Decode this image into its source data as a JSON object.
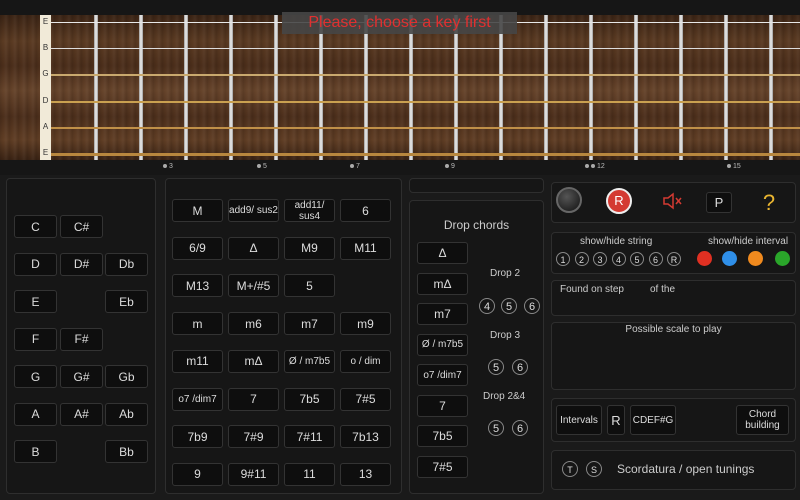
{
  "fretboard": {
    "strings": [
      "E",
      "B",
      "G",
      "D",
      "A",
      "E"
    ],
    "markers": [
      "3",
      "5",
      "7",
      "9",
      "12",
      "15"
    ],
    "banner": "Please, choose a key first"
  },
  "keys": [
    [
      "C",
      "C#",
      ""
    ],
    [
      "D",
      "D#",
      "Db"
    ],
    [
      "E",
      "",
      "Eb"
    ],
    [
      "F",
      "F#",
      ""
    ],
    [
      "G",
      "G#",
      "Gb"
    ],
    [
      "A",
      "A#",
      "Ab"
    ],
    [
      "B",
      "",
      "Bb"
    ]
  ],
  "chords": [
    [
      "M",
      "add9/ sus2",
      "add11/ sus4",
      "6"
    ],
    [
      "6/9",
      "Δ",
      "M9",
      "M11"
    ],
    [
      "M13",
      "M+/#5",
      "5",
      ""
    ],
    [
      "m",
      "m6",
      "m7",
      "m9"
    ],
    [
      "m11",
      "mΔ",
      "Ø / m7b5",
      "o / dim"
    ],
    [
      "o7 /dim7",
      "7",
      "7b5",
      "7#5"
    ],
    [
      "7b9",
      "7#9",
      "7#11",
      "7b13"
    ],
    [
      "9",
      "9#11",
      "11",
      "13"
    ]
  ],
  "drop": {
    "title": "Drop chords",
    "chords": [
      "Δ",
      "mΔ",
      "m7",
      "Ø / m7b5",
      "o7 /dim7",
      "7",
      "7b5",
      "7#5"
    ],
    "drop2": {
      "label": "Drop 2",
      "nums": [
        "4",
        "5",
        "6"
      ]
    },
    "drop3": {
      "label": "Drop 3",
      "nums": [
        "5",
        "6"
      ]
    },
    "drop24": {
      "label": "Drop 2&4",
      "nums": [
        "5",
        "6"
      ]
    }
  },
  "tools": {
    "record_label": "R",
    "p_label": "P",
    "help_label": "?",
    "record_color": "#d43a32",
    "help_color": "#e9b530"
  },
  "show": {
    "string_label": "show/hide string",
    "interval_label": "show/hide interval",
    "strings": [
      "1",
      "2",
      "3",
      "4",
      "5",
      "6",
      "R"
    ],
    "colors": [
      "#e03022",
      "#2f8fe8",
      "#f08a1e",
      "#2aa62a"
    ]
  },
  "found": {
    "label": "Found on step",
    "of": "of the"
  },
  "scale": {
    "label": "Possible scale to play"
  },
  "bottom": {
    "intervals": "Intervals",
    "r": "R",
    "notes": "CDEF#G",
    "chord_building": "Chord building"
  },
  "scordatura": {
    "t": "T",
    "s": "S",
    "label": "Scordatura / open tunings"
  }
}
